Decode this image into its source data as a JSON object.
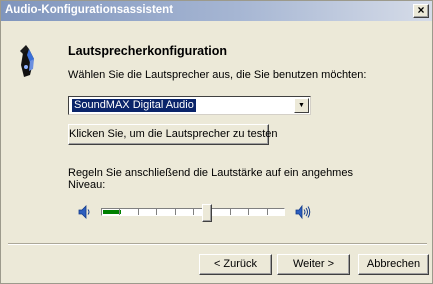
{
  "window": {
    "title": "Audio-Konfigurationsassistent",
    "close_label": "×"
  },
  "header": {
    "heading": "Lautsprecherkonfiguration",
    "instruction": "Wählen Sie die Lautsprecher aus, die Sie benutzen möchten:"
  },
  "speaker_select": {
    "value": "SoundMAX Digital Audio",
    "arrow": "▼"
  },
  "test_button": {
    "label": "Klicken Sie, um die Lautsprecher zu testen"
  },
  "volume": {
    "instruction": "Regeln Sie anschließend die Lautstärke auf ein angehmes Niveau:",
    "level_fraction": 0.58
  },
  "footer": {
    "back_label": "< Zurück",
    "next_label": "Weiter >",
    "cancel_label": "Abbrechen"
  },
  "icons": {
    "header": "speaker-wizard-icon",
    "volume_low": "speaker-low-icon",
    "volume_high": "speaker-high-icon"
  },
  "colors": {
    "titlebar_start": "#7f95bd",
    "selection": "#0a246a",
    "volume_fill": "#008000"
  }
}
